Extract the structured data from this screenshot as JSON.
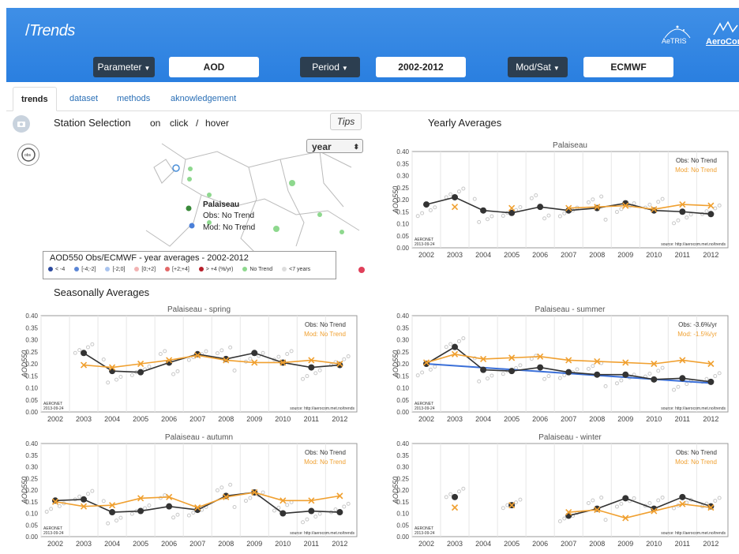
{
  "header": {
    "brand": "Trends",
    "logo1": "AeTRIS",
    "logo2": "AeroCom",
    "controls": [
      {
        "label": "Parameter",
        "value": "AOD"
      },
      {
        "label": "Period",
        "value": "2002-2012"
      },
      {
        "label": "Mod/Sat",
        "value": "ECMWF"
      }
    ]
  },
  "tabs": [
    "trends",
    "dataset",
    "methods",
    "aknowledgement"
  ],
  "station": {
    "title": "Station Selection",
    "on": "on",
    "click": "click",
    "slash": "/",
    "hover": "hover",
    "tips": "Tips",
    "select_value": "year",
    "popup": {
      "name": "Palaiseau",
      "obs": "Obs: No Trend",
      "mod": "Mod: No Trend"
    },
    "legend_title": "AOD550 Obs/ECMWF - year averages - 2002-2012",
    "legend_items": [
      "< -4",
      "[-4;-2]",
      "[-2;0]",
      "[0;+2]",
      "[+2;+4]",
      "> +4 (%/yr)",
      "No Trend",
      "<7 years"
    ],
    "legend_colors": [
      "#2c4a9e",
      "#5b86d6",
      "#a9c4ef",
      "#f2b2b2",
      "#e36868",
      "#b61f2a",
      "#8ed88e",
      "#dddddd"
    ]
  },
  "yearly_title": "Yearly Averages",
  "seasonal_title": "Seasonally Averages",
  "chart_data": [
    {
      "type": "line",
      "title": "Palaiseau",
      "x": [
        2002,
        2003,
        2004,
        2005,
        2006,
        2007,
        2008,
        2009,
        2010,
        2011,
        2012
      ],
      "ylim": [
        0,
        0.4
      ],
      "ylabel": "AOD550",
      "series": [
        {
          "name": "Obs: No Trend",
          "color": "#333333",
          "values": [
            0.18,
            0.21,
            0.155,
            0.145,
            0.17,
            0.155,
            0.165,
            0.185,
            0.155,
            0.15,
            0.14
          ]
        },
        {
          "name": "Mod: No Trend",
          "color": "#f0a030",
          "values": [
            null,
            0.17,
            null,
            0.165,
            null,
            0.165,
            0.17,
            0.175,
            0.16,
            0.18,
            0.175
          ]
        }
      ],
      "footer_left": "AERONET",
      "footer_left2": "2013-09-24",
      "footer_right": "source: http://aerocom.met.no/trends",
      "xlabel": ""
    },
    {
      "type": "line",
      "title": "Palaiseau - spring",
      "x": [
        2002,
        2003,
        2004,
        2005,
        2006,
        2007,
        2008,
        2009,
        2010,
        2011,
        2012
      ],
      "ylim": [
        0,
        0.4
      ],
      "ylabel": "AOD550",
      "series": [
        {
          "name": "Obs: No Trend",
          "color": "#333333",
          "values": [
            null,
            0.245,
            0.17,
            0.165,
            0.205,
            0.24,
            0.22,
            0.245,
            0.205,
            0.185,
            0.195
          ]
        },
        {
          "name": "Mod: No Trend",
          "color": "#f0a030",
          "values": [
            null,
            0.195,
            0.185,
            0.2,
            0.215,
            0.235,
            0.215,
            0.205,
            0.205,
            0.215,
            0.2
          ]
        }
      ],
      "footer_left": "AERONET",
      "footer_left2": "2013-09-24",
      "footer_right": "source: http://aerocom.met.no/trends",
      "xlabel": ""
    },
    {
      "type": "line",
      "title": "Palaiseau - summer",
      "x": [
        2002,
        2003,
        2004,
        2005,
        2006,
        2007,
        2008,
        2009,
        2010,
        2011,
        2012
      ],
      "ylim": [
        0,
        0.4
      ],
      "ylabel": "AOD550",
      "series": [
        {
          "name": "Obs: -3.6%/yr",
          "color": "#333333",
          "values": [
            0.2,
            0.27,
            0.175,
            0.17,
            0.185,
            0.165,
            0.155,
            0.155,
            0.135,
            0.14,
            0.125
          ]
        },
        {
          "name": "Mod: -1.5%/yr",
          "color": "#f0a030",
          "values": [
            0.205,
            0.24,
            0.22,
            0.225,
            0.23,
            0.215,
            0.21,
            0.205,
            0.2,
            0.215,
            0.2
          ]
        }
      ],
      "trend": {
        "color": "#3a6fd8",
        "from": [
          2002,
          0.2
        ],
        "to": [
          2012,
          0.12
        ]
      },
      "footer_left": "AERONET",
      "footer_left2": "2013-09-24",
      "footer_right": "source: http://aerocom.met.no/trends",
      "xlabel": ""
    },
    {
      "type": "line",
      "title": "Palaiseau - autumn",
      "x": [
        2002,
        2003,
        2004,
        2005,
        2006,
        2007,
        2008,
        2009,
        2010,
        2011,
        2012
      ],
      "ylim": [
        0,
        0.4
      ],
      "ylabel": "AOD550",
      "series": [
        {
          "name": "Obs: No Trend",
          "color": "#333333",
          "values": [
            0.155,
            0.16,
            0.105,
            0.11,
            0.13,
            0.115,
            0.175,
            0.19,
            0.1,
            0.11,
            0.105
          ]
        },
        {
          "name": "Mod: No Trend",
          "color": "#f0a030",
          "values": [
            0.15,
            0.13,
            0.135,
            0.165,
            0.17,
            0.125,
            0.17,
            0.19,
            0.155,
            0.155,
            0.175
          ]
        }
      ],
      "footer_left": "AERONET",
      "footer_left2": "2013-09-24",
      "footer_right": "source: http://aerocom.met.no/trends",
      "xlabel": ""
    },
    {
      "type": "line",
      "title": "Palaiseau - winter",
      "x": [
        2002,
        2003,
        2004,
        2005,
        2006,
        2007,
        2008,
        2009,
        2010,
        2011,
        2012
      ],
      "ylim": [
        0,
        0.4
      ],
      "ylabel": "AOD550",
      "series": [
        {
          "name": "Obs: No Trend",
          "color": "#333333",
          "values": [
            null,
            0.17,
            null,
            0.135,
            null,
            0.09,
            0.12,
            0.165,
            0.12,
            0.17,
            0.13
          ]
        },
        {
          "name": "Mod: No Trend",
          "color": "#f0a030",
          "values": [
            null,
            0.125,
            null,
            0.135,
            null,
            0.105,
            0.115,
            0.08,
            0.11,
            0.14,
            0.125
          ]
        }
      ],
      "footer_left": "AERONET",
      "footer_left2": "2013-09-24",
      "footer_right": "source: http://aerocom.met.no/trends",
      "xlabel": ""
    }
  ]
}
